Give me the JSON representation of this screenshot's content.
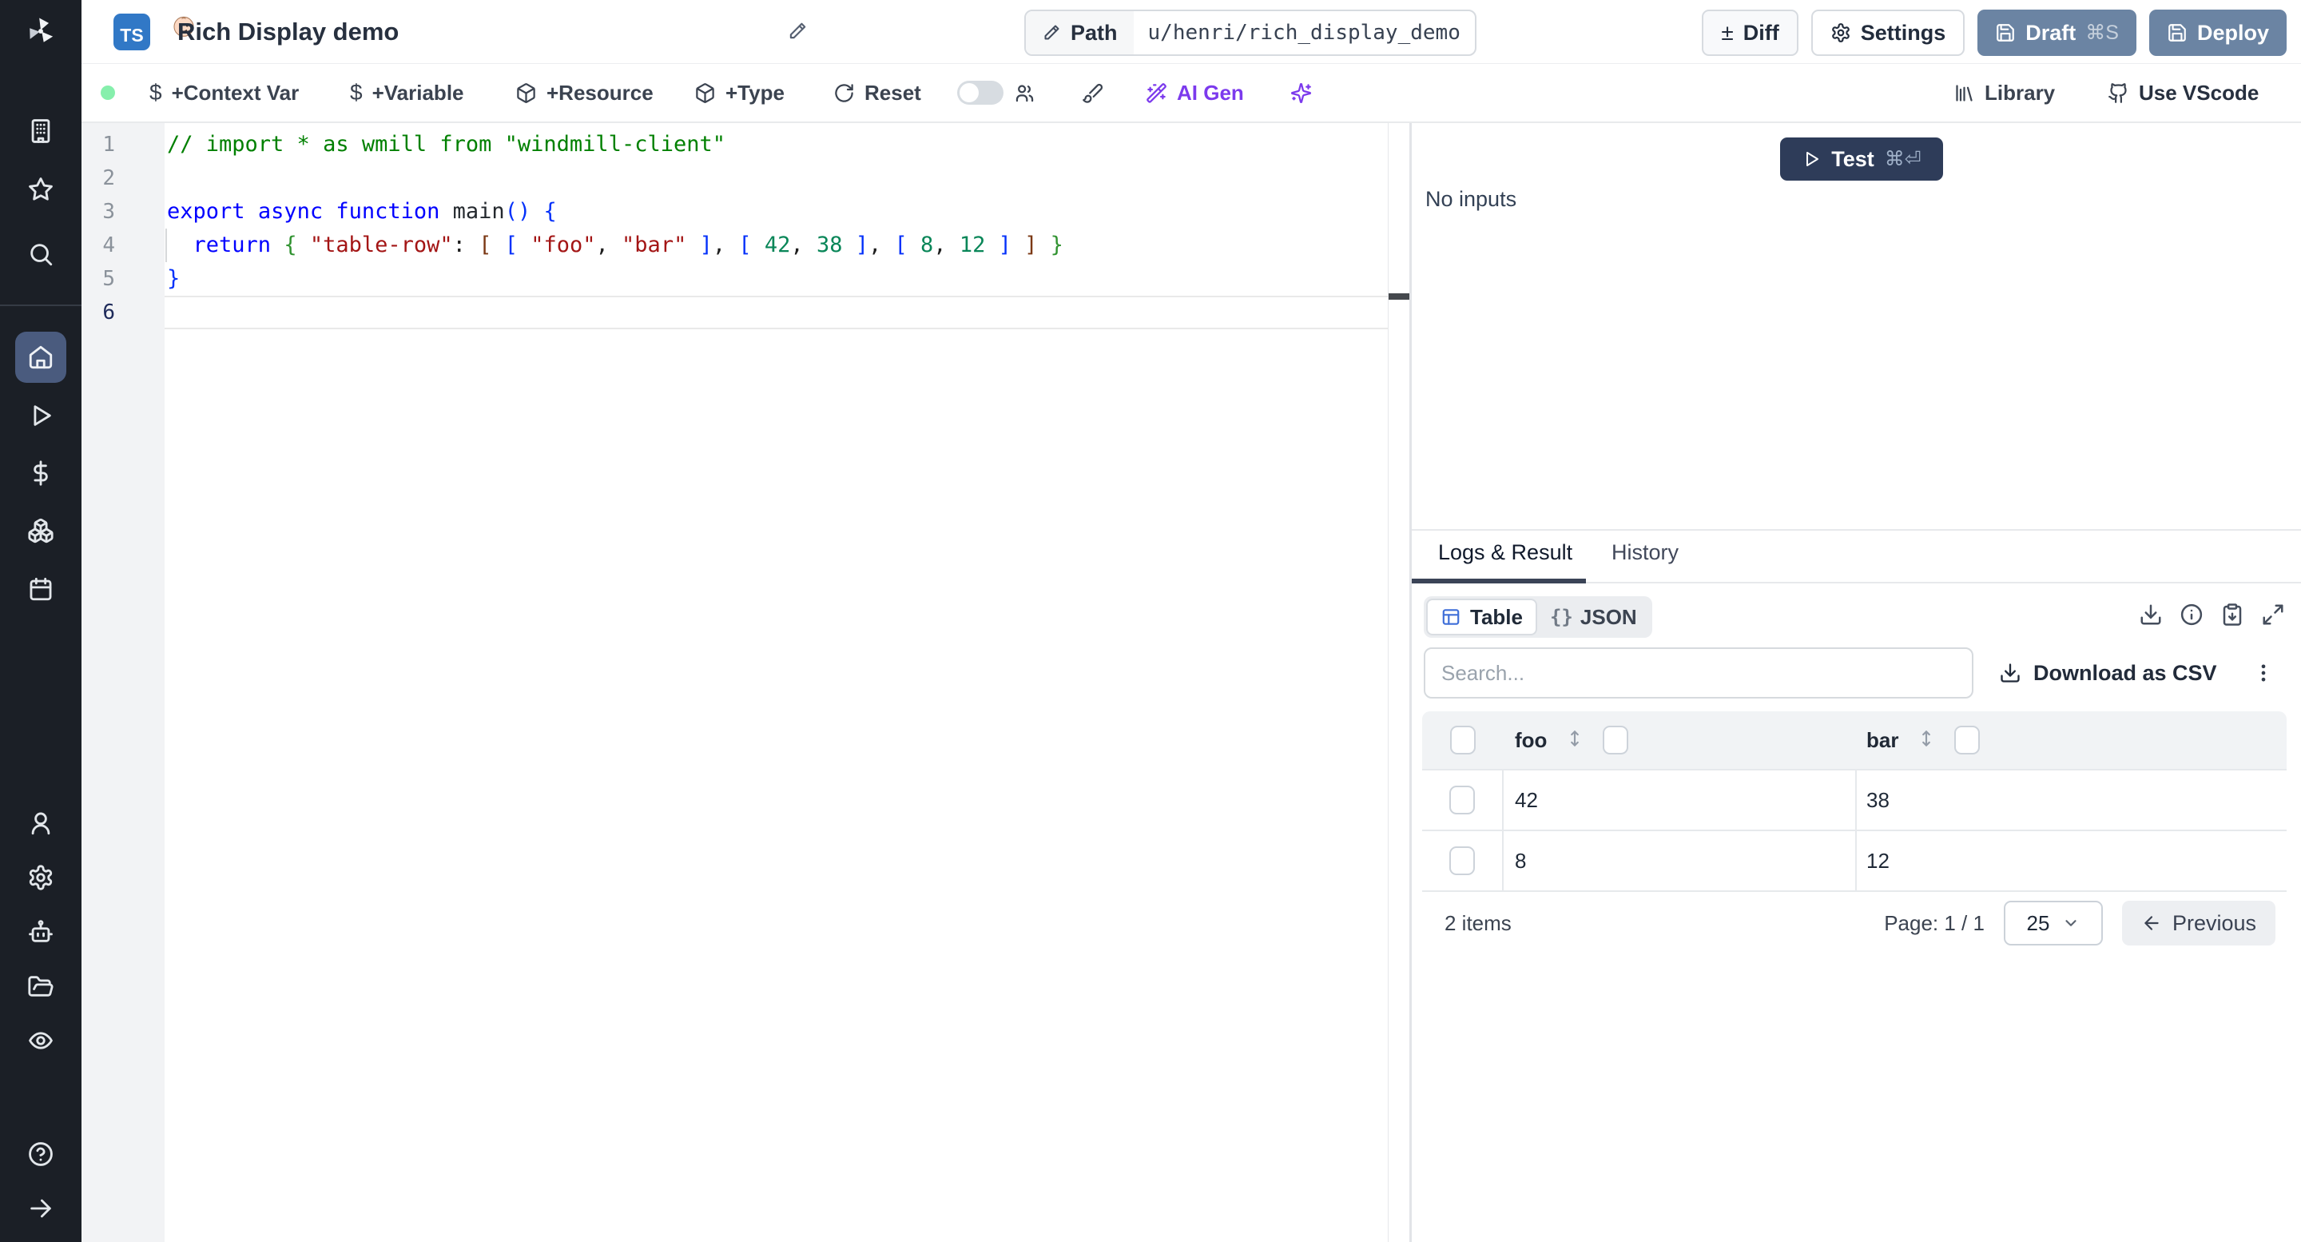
{
  "header": {
    "title": "Rich Display demo",
    "ts_badge": "TS",
    "path_label": "Path",
    "path_value": "u/henri/rich_display_demo",
    "diff": "Diff",
    "settings": "Settings",
    "draft": "Draft",
    "draft_shortcut": "⌘S",
    "deploy": "Deploy"
  },
  "toolbar": {
    "context_var": "+Context Var",
    "variable": "+Variable",
    "resource": "+Resource",
    "type": "+Type",
    "reset": "Reset",
    "ai_gen": "AI Gen",
    "library": "Library",
    "use_vscode": "Use VScode",
    "dollar": "$"
  },
  "sidebar": {
    "icons": [
      "windmill-logo",
      "workspace-building",
      "favorites-star",
      "search",
      "home",
      "runs-play",
      "variables-dollar",
      "resources-boxes",
      "schedules-calendar",
      "users-person",
      "settings-gear",
      "workers-robot",
      "folders",
      "audit-eye",
      "help-question",
      "collapse-arrow-right"
    ]
  },
  "editor": {
    "lines": [
      {
        "num": "1",
        "tokens": [
          {
            "t": "// import * as wmill from \"windmill-client\"",
            "c": "comment"
          }
        ]
      },
      {
        "num": "2",
        "tokens": []
      },
      {
        "num": "3",
        "tokens": [
          {
            "t": "export",
            "c": "keyword"
          },
          {
            "t": " ",
            "c": "plain"
          },
          {
            "t": "async",
            "c": "keyword"
          },
          {
            "t": " ",
            "c": "plain"
          },
          {
            "t": "function",
            "c": "keyword"
          },
          {
            "t": " main",
            "c": "fn"
          },
          {
            "t": "() {",
            "c": "b1"
          }
        ]
      },
      {
        "num": "4",
        "guide": true,
        "tokens": [
          {
            "t": "  ",
            "c": "plain"
          },
          {
            "t": "return",
            "c": "keyword"
          },
          {
            "t": " ",
            "c": "plain"
          },
          {
            "t": "{",
            "c": "b2"
          },
          {
            "t": " ",
            "c": "plain"
          },
          {
            "t": "\"table-row\"",
            "c": "string"
          },
          {
            "t": ": ",
            "c": "plain"
          },
          {
            "t": "[",
            "c": "b3"
          },
          {
            "t": " ",
            "c": "plain"
          },
          {
            "t": "[",
            "c": "b1"
          },
          {
            "t": " ",
            "c": "plain"
          },
          {
            "t": "\"foo\"",
            "c": "string"
          },
          {
            "t": ", ",
            "c": "plain"
          },
          {
            "t": "\"bar\"",
            "c": "string"
          },
          {
            "t": " ",
            "c": "plain"
          },
          {
            "t": "]",
            "c": "b1"
          },
          {
            "t": ", ",
            "c": "plain"
          },
          {
            "t": "[",
            "c": "b1"
          },
          {
            "t": " ",
            "c": "plain"
          },
          {
            "t": "42",
            "c": "number"
          },
          {
            "t": ", ",
            "c": "plain"
          },
          {
            "t": "38",
            "c": "number"
          },
          {
            "t": " ",
            "c": "plain"
          },
          {
            "t": "]",
            "c": "b1"
          },
          {
            "t": ", ",
            "c": "plain"
          },
          {
            "t": "[",
            "c": "b1"
          },
          {
            "t": " ",
            "c": "plain"
          },
          {
            "t": "8",
            "c": "number"
          },
          {
            "t": ", ",
            "c": "plain"
          },
          {
            "t": "12",
            "c": "number"
          },
          {
            "t": " ",
            "c": "plain"
          },
          {
            "t": "]",
            "c": "b1"
          },
          {
            "t": " ",
            "c": "plain"
          },
          {
            "t": "]",
            "c": "b3"
          },
          {
            "t": " ",
            "c": "plain"
          },
          {
            "t": "}",
            "c": "b2"
          }
        ]
      },
      {
        "num": "5",
        "tokens": [
          {
            "t": "}",
            "c": "b1"
          }
        ]
      },
      {
        "num": "6",
        "current": true,
        "tokens": []
      }
    ]
  },
  "run": {
    "test": "Test",
    "test_shortcut": "⌘⏎",
    "no_inputs": "No inputs"
  },
  "tabs": {
    "logs_result": "Logs & Result",
    "history": "History"
  },
  "result": {
    "view_table": "Table",
    "view_json": "JSON",
    "braces": "{}",
    "search_placeholder": "Search...",
    "download_csv": "Download as CSV"
  },
  "result_table": {
    "columns": [
      "foo",
      "bar"
    ],
    "rows": [
      {
        "foo": "42",
        "bar": "38"
      },
      {
        "foo": "8",
        "bar": "12"
      }
    ],
    "items_label": "2 items",
    "page_label": "Page: 1 / 1",
    "page_size": "25",
    "previous": "Previous"
  },
  "colors": {
    "primary_button_blue": "#6b84a3",
    "test_button_navy": "#2e3c59",
    "ai_purple": "#7c3aed",
    "status_green_dot": "#86efac",
    "ts_badge_blue": "#3178c6",
    "table_icon_blue": "#3e6ed8",
    "sidebar_bg": "#1b1f26",
    "sidebar_active_bg": "#4a5b7e"
  }
}
